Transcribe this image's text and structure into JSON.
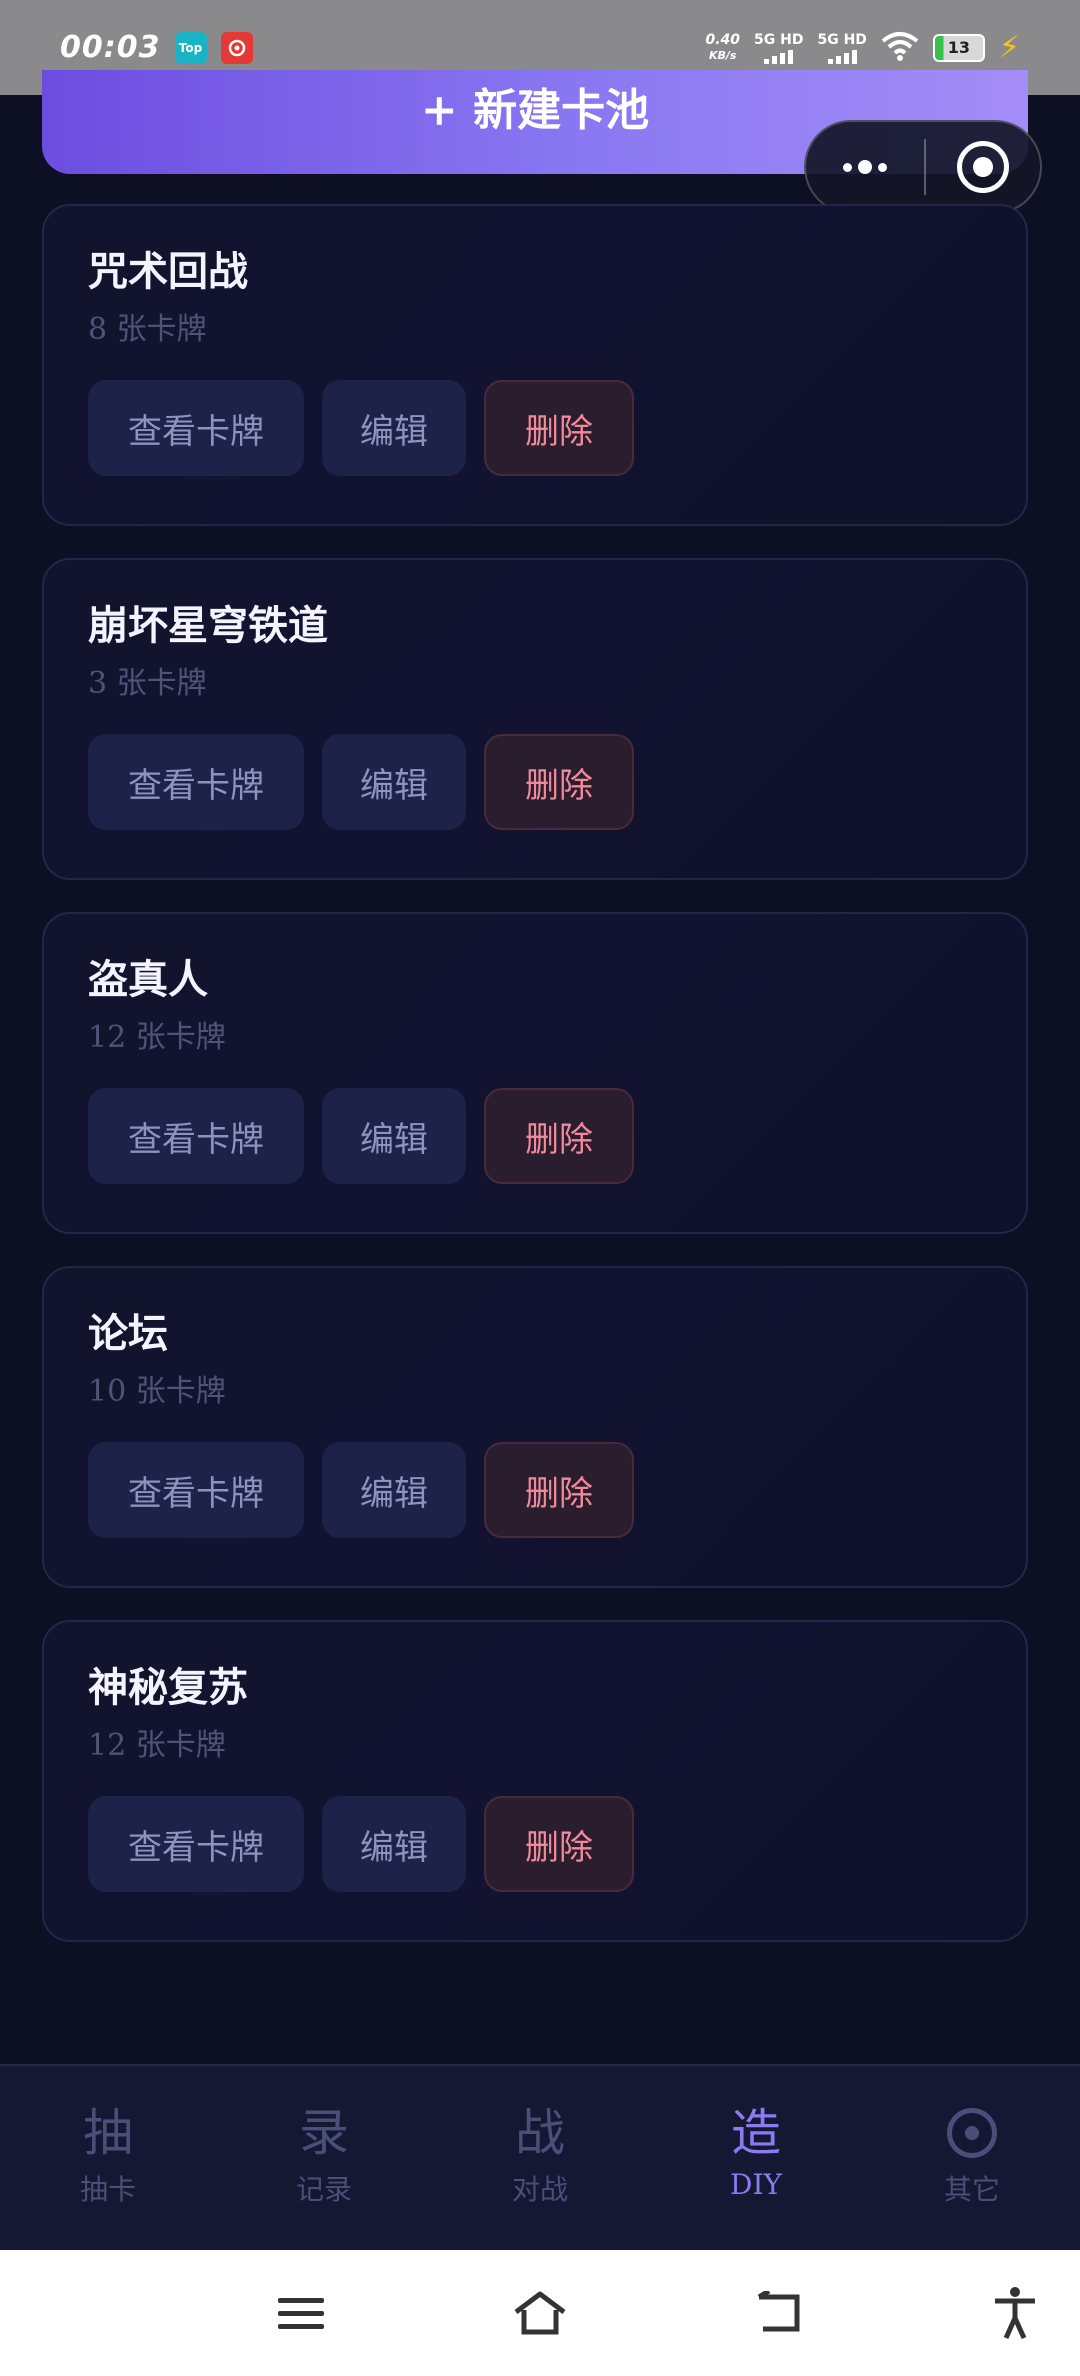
{
  "status_bar": {
    "time": "00:03",
    "app_icons": [
      "Top",
      "netease-music-icon"
    ],
    "net_speed_value": "0.40",
    "net_speed_unit": "KB/s",
    "signal_1": "5G HD",
    "signal_2": "5G HD",
    "battery": "13"
  },
  "banner": {
    "label": "+ 新建卡池"
  },
  "capsule": {
    "more_icon": "more-dots-icon",
    "close_icon": "target-close-icon"
  },
  "cards": [
    {
      "title": "咒术回战",
      "count": "8 张卡牌",
      "view": "查看卡牌",
      "edit": "编辑",
      "delete": "删除"
    },
    {
      "title": "崩坏星穹铁道",
      "count": "3 张卡牌",
      "view": "查看卡牌",
      "edit": "编辑",
      "delete": "删除"
    },
    {
      "title": "盗真人",
      "count": "12 张卡牌",
      "view": "查看卡牌",
      "edit": "编辑",
      "delete": "删除"
    },
    {
      "title": "论坛",
      "count": "10 张卡牌",
      "view": "查看卡牌",
      "edit": "编辑",
      "delete": "删除"
    },
    {
      "title": "神秘复苏",
      "count": "12 张卡牌",
      "view": "查看卡牌",
      "edit": "编辑",
      "delete": "删除"
    }
  ],
  "tabs": [
    {
      "glyph": "抽",
      "label": "抽卡",
      "active": false
    },
    {
      "glyph": "录",
      "label": "记录",
      "active": false
    },
    {
      "glyph": "战",
      "label": "对战",
      "active": false
    },
    {
      "glyph": "造",
      "label": "DIY",
      "active": true
    },
    {
      "glyph": "",
      "label": "其它",
      "active": false,
      "icon": "gear-icon"
    }
  ],
  "colors": {
    "background": "#0d0f22",
    "accent": "#8d79f0",
    "delete": "#f08a9a"
  }
}
